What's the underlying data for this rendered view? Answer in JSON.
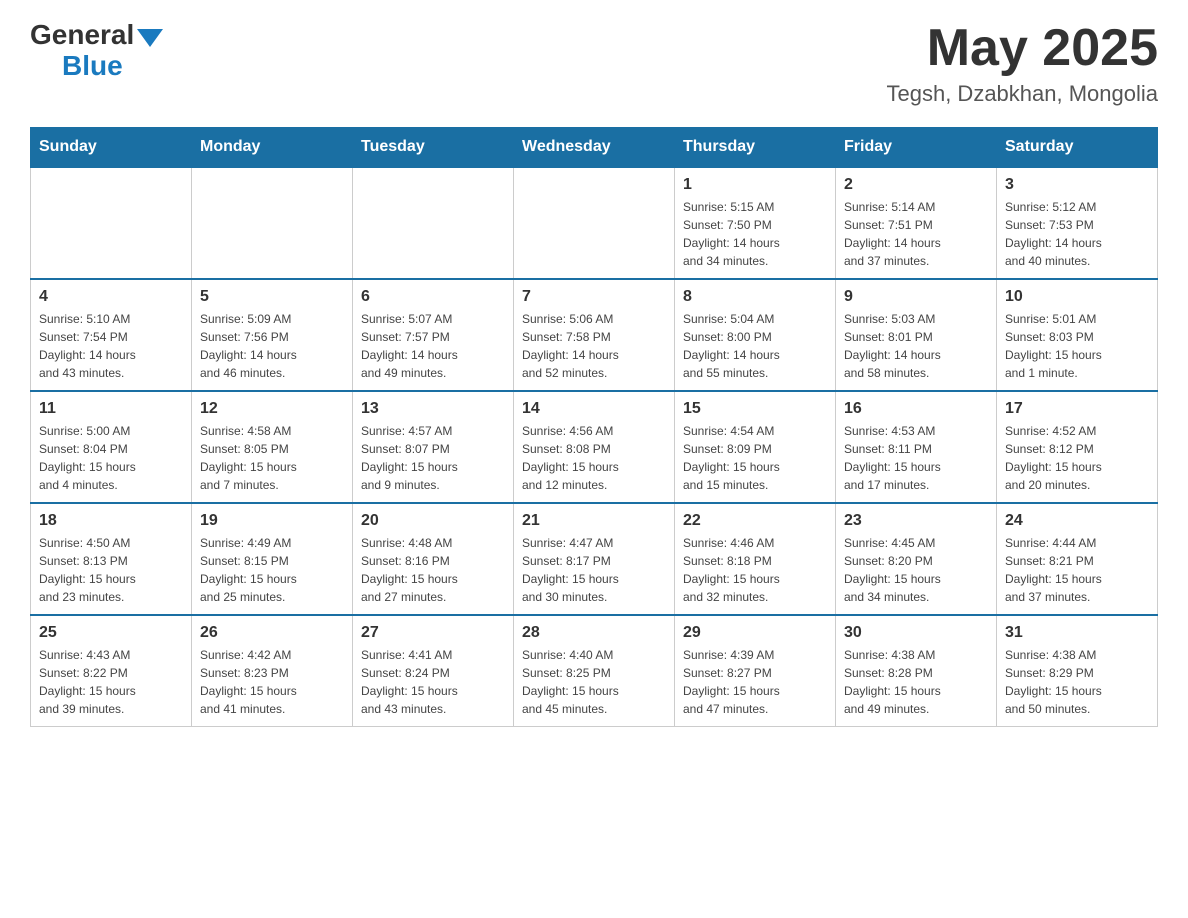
{
  "header": {
    "logo_general": "General",
    "logo_blue": "Blue",
    "month_year": "May 2025",
    "location": "Tegsh, Dzabkhan, Mongolia"
  },
  "days_of_week": [
    "Sunday",
    "Monday",
    "Tuesday",
    "Wednesday",
    "Thursday",
    "Friday",
    "Saturday"
  ],
  "weeks": [
    {
      "days": [
        {
          "num": "",
          "info": ""
        },
        {
          "num": "",
          "info": ""
        },
        {
          "num": "",
          "info": ""
        },
        {
          "num": "",
          "info": ""
        },
        {
          "num": "1",
          "info": "Sunrise: 5:15 AM\nSunset: 7:50 PM\nDaylight: 14 hours\nand 34 minutes."
        },
        {
          "num": "2",
          "info": "Sunrise: 5:14 AM\nSunset: 7:51 PM\nDaylight: 14 hours\nand 37 minutes."
        },
        {
          "num": "3",
          "info": "Sunrise: 5:12 AM\nSunset: 7:53 PM\nDaylight: 14 hours\nand 40 minutes."
        }
      ]
    },
    {
      "days": [
        {
          "num": "4",
          "info": "Sunrise: 5:10 AM\nSunset: 7:54 PM\nDaylight: 14 hours\nand 43 minutes."
        },
        {
          "num": "5",
          "info": "Sunrise: 5:09 AM\nSunset: 7:56 PM\nDaylight: 14 hours\nand 46 minutes."
        },
        {
          "num": "6",
          "info": "Sunrise: 5:07 AM\nSunset: 7:57 PM\nDaylight: 14 hours\nand 49 minutes."
        },
        {
          "num": "7",
          "info": "Sunrise: 5:06 AM\nSunset: 7:58 PM\nDaylight: 14 hours\nand 52 minutes."
        },
        {
          "num": "8",
          "info": "Sunrise: 5:04 AM\nSunset: 8:00 PM\nDaylight: 14 hours\nand 55 minutes."
        },
        {
          "num": "9",
          "info": "Sunrise: 5:03 AM\nSunset: 8:01 PM\nDaylight: 14 hours\nand 58 minutes."
        },
        {
          "num": "10",
          "info": "Sunrise: 5:01 AM\nSunset: 8:03 PM\nDaylight: 15 hours\nand 1 minute."
        }
      ]
    },
    {
      "days": [
        {
          "num": "11",
          "info": "Sunrise: 5:00 AM\nSunset: 8:04 PM\nDaylight: 15 hours\nand 4 minutes."
        },
        {
          "num": "12",
          "info": "Sunrise: 4:58 AM\nSunset: 8:05 PM\nDaylight: 15 hours\nand 7 minutes."
        },
        {
          "num": "13",
          "info": "Sunrise: 4:57 AM\nSunset: 8:07 PM\nDaylight: 15 hours\nand 9 minutes."
        },
        {
          "num": "14",
          "info": "Sunrise: 4:56 AM\nSunset: 8:08 PM\nDaylight: 15 hours\nand 12 minutes."
        },
        {
          "num": "15",
          "info": "Sunrise: 4:54 AM\nSunset: 8:09 PM\nDaylight: 15 hours\nand 15 minutes."
        },
        {
          "num": "16",
          "info": "Sunrise: 4:53 AM\nSunset: 8:11 PM\nDaylight: 15 hours\nand 17 minutes."
        },
        {
          "num": "17",
          "info": "Sunrise: 4:52 AM\nSunset: 8:12 PM\nDaylight: 15 hours\nand 20 minutes."
        }
      ]
    },
    {
      "days": [
        {
          "num": "18",
          "info": "Sunrise: 4:50 AM\nSunset: 8:13 PM\nDaylight: 15 hours\nand 23 minutes."
        },
        {
          "num": "19",
          "info": "Sunrise: 4:49 AM\nSunset: 8:15 PM\nDaylight: 15 hours\nand 25 minutes."
        },
        {
          "num": "20",
          "info": "Sunrise: 4:48 AM\nSunset: 8:16 PM\nDaylight: 15 hours\nand 27 minutes."
        },
        {
          "num": "21",
          "info": "Sunrise: 4:47 AM\nSunset: 8:17 PM\nDaylight: 15 hours\nand 30 minutes."
        },
        {
          "num": "22",
          "info": "Sunrise: 4:46 AM\nSunset: 8:18 PM\nDaylight: 15 hours\nand 32 minutes."
        },
        {
          "num": "23",
          "info": "Sunrise: 4:45 AM\nSunset: 8:20 PM\nDaylight: 15 hours\nand 34 minutes."
        },
        {
          "num": "24",
          "info": "Sunrise: 4:44 AM\nSunset: 8:21 PM\nDaylight: 15 hours\nand 37 minutes."
        }
      ]
    },
    {
      "days": [
        {
          "num": "25",
          "info": "Sunrise: 4:43 AM\nSunset: 8:22 PM\nDaylight: 15 hours\nand 39 minutes."
        },
        {
          "num": "26",
          "info": "Sunrise: 4:42 AM\nSunset: 8:23 PM\nDaylight: 15 hours\nand 41 minutes."
        },
        {
          "num": "27",
          "info": "Sunrise: 4:41 AM\nSunset: 8:24 PM\nDaylight: 15 hours\nand 43 minutes."
        },
        {
          "num": "28",
          "info": "Sunrise: 4:40 AM\nSunset: 8:25 PM\nDaylight: 15 hours\nand 45 minutes."
        },
        {
          "num": "29",
          "info": "Sunrise: 4:39 AM\nSunset: 8:27 PM\nDaylight: 15 hours\nand 47 minutes."
        },
        {
          "num": "30",
          "info": "Sunrise: 4:38 AM\nSunset: 8:28 PM\nDaylight: 15 hours\nand 49 minutes."
        },
        {
          "num": "31",
          "info": "Sunrise: 4:38 AM\nSunset: 8:29 PM\nDaylight: 15 hours\nand 50 minutes."
        }
      ]
    }
  ]
}
